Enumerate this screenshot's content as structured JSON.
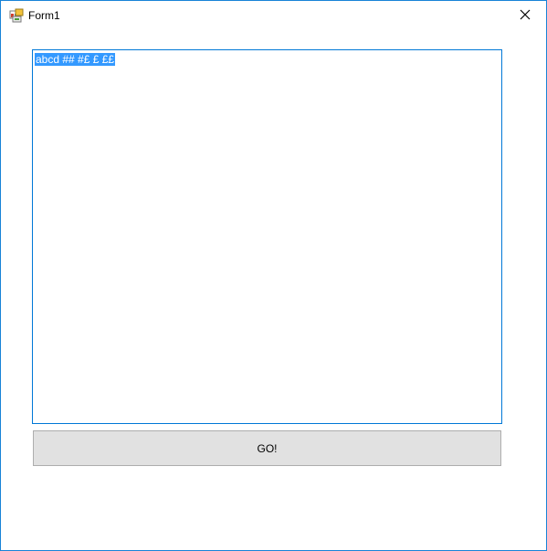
{
  "window": {
    "title": "Form1",
    "icon": "winforms-app-icon",
    "close_icon": "close-icon"
  },
  "textbox": {
    "value": "abcd ## #£ £ ££",
    "selected": true,
    "selection_color": "#3399ff",
    "border_color": "#0078d7"
  },
  "button": {
    "label": "GO!",
    "background": "#e1e1e1"
  },
  "colors": {
    "window_border": "#1883d7"
  }
}
